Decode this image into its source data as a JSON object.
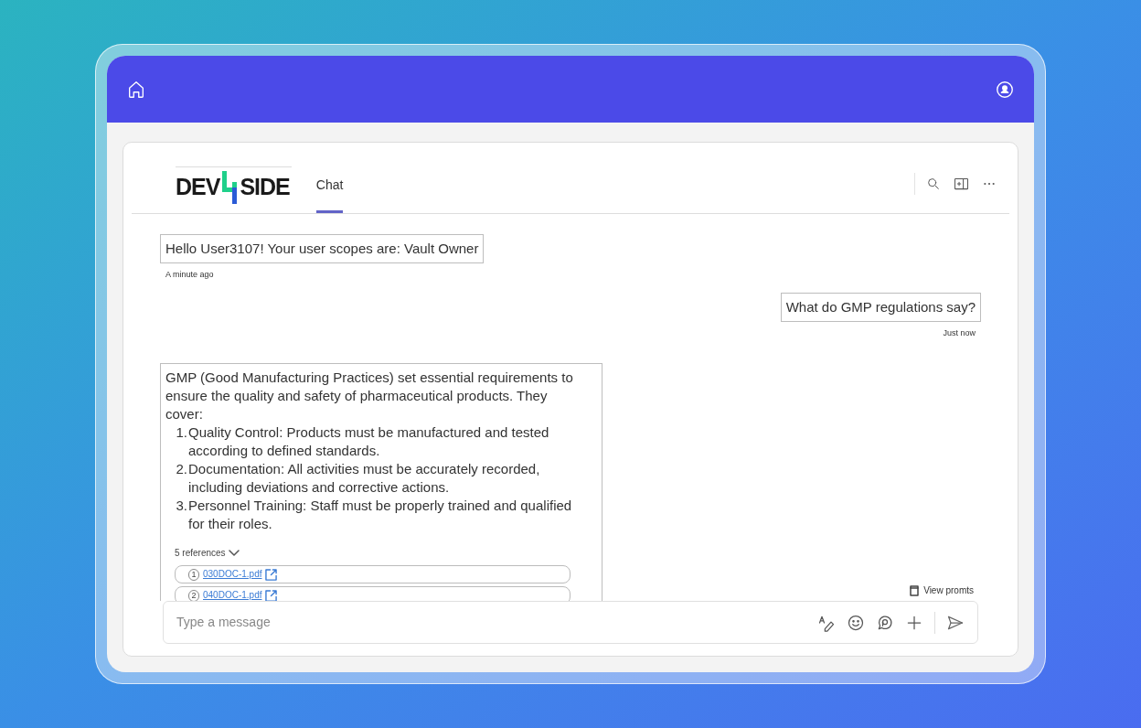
{
  "logo": {
    "left": "DEV",
    "right": "SIDE"
  },
  "tabs": [
    {
      "label": "Chat",
      "selected": true
    }
  ],
  "messages": [
    {
      "kind": "bot",
      "text": "Hello User3107! Your user scopes are: Vault Owner",
      "time": "A minute ago"
    },
    {
      "kind": "user",
      "text": "What do GMP regulations say?",
      "time": "Just now"
    },
    {
      "kind": "bot",
      "text": "GMP (Good Manufacturing Practices) set essential requirements to ensure the quality and safety of pharmaceutical products. They cover:",
      "list": [
        {
          "number": "1.",
          "text": "Quality Control: Products must be manufactured and tested according to defined standards."
        },
        {
          "number": "2.",
          "text": "Documentation: All activities must be accurately recorded, including deviations and corrective actions."
        },
        {
          "number": "3.",
          "text": "Personnel Training: Staff must be properly trained and qualified for their roles."
        }
      ],
      "references_label": "5 references",
      "references": [
        {
          "number": "1",
          "file": "030DOC-1.pdf"
        },
        {
          "number": "2",
          "file": "040DOC-1.pdf"
        }
      ]
    }
  ],
  "view_prompts": "View promts",
  "composer": {
    "placeholder": "Type a message"
  }
}
